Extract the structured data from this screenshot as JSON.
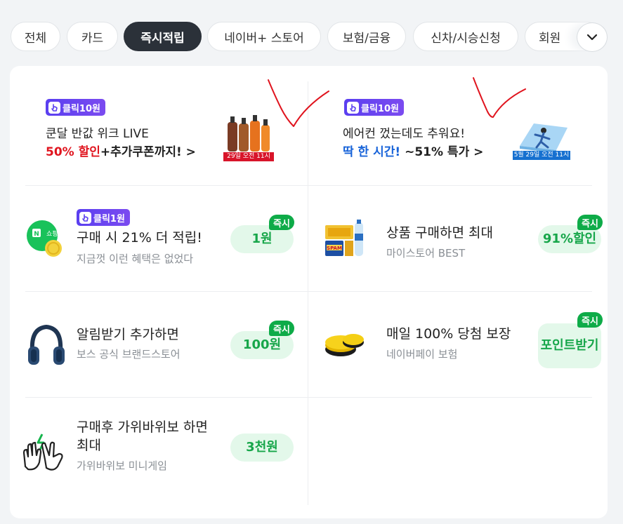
{
  "tabs": [
    {
      "label": "전체",
      "active": false
    },
    {
      "label": "카드",
      "active": false
    },
    {
      "label": "즉시적립",
      "active": true
    },
    {
      "label": "네이버+ 스토어",
      "active": false
    },
    {
      "label": "보험/금융",
      "active": false
    },
    {
      "label": "신차/시승신청",
      "active": false
    },
    {
      "label": "회원",
      "active": false
    }
  ],
  "more_icon": "chevron-down-icon",
  "promos": [
    {
      "badge": "클릭10원",
      "line1": "쿤달 반값 위크 LIVE",
      "line2_highlight": "50% 할인",
      "line2_rest": "+추가쿠폰까지! >",
      "thumb_caption": "29일 오전 11시",
      "highlight_color": "#e0141e"
    },
    {
      "badge": "클릭10원",
      "line1": "에어컨 껐는데도 추워요!",
      "line2_highlight": "딱 한 시간!",
      "line2_rest": " ~51% 특가 >",
      "thumb_caption": "5월 29일 오전 11시",
      "highlight_color": "#1763d9"
    }
  ],
  "offers": [
    {
      "badge": "클릭1원",
      "title": "구매 시 21% 더 적립!",
      "subtitle": "지금껏 이런 혜택은 없었다",
      "reward": "1원",
      "instant": "즉시",
      "icon": "naver-shopping-coin-icon"
    },
    {
      "badge": "",
      "title": "상품 구매하면 최대",
      "subtitle": "마이스토어 BEST",
      "reward": "91%할인",
      "instant": "즉시",
      "icon": "spam-gift-set-icon"
    },
    {
      "badge": "",
      "title": "알림받기 추가하면",
      "subtitle": "보스 공식 브랜드스토어",
      "reward": "100원",
      "instant": "즉시",
      "icon": "headphones-icon"
    },
    {
      "badge": "",
      "title": "매일 100% 당첨 보장",
      "subtitle": "네이버페이 보험",
      "reward": "포인트받기",
      "instant": "즉시",
      "icon": "gold-coins-icon"
    },
    {
      "badge": "",
      "title": "구매후 가위바위보 하면 최대",
      "subtitle": "가위바위보 미니게임",
      "reward": "3천원",
      "instant": "",
      "icon": "rock-paper-scissors-icon"
    }
  ],
  "colors": {
    "instant_badge": "#0eab48",
    "reward_pill_bg": "#e3f8ea",
    "reward_text": "#17a64a",
    "click_badge": "#5a3ff0",
    "active_tab": "#2b3139",
    "annotation_marks": "#e0141e"
  }
}
